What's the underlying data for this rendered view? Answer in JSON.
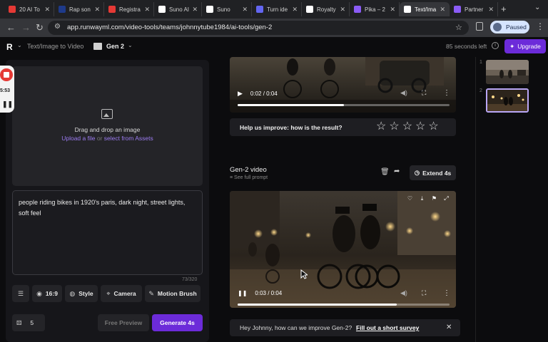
{
  "browser": {
    "tabs": [
      {
        "label": "20 AI To",
        "color": "#e53935"
      },
      {
        "label": "Rap son",
        "color": "#1e3a8a"
      },
      {
        "label": "Registra",
        "color": "#e53935"
      },
      {
        "label": "Suno AI",
        "color": "#ffffff"
      },
      {
        "label": "Suno",
        "color": "#ffffff"
      },
      {
        "label": "Turn ide",
        "color": "#6366f1"
      },
      {
        "label": "Royalty",
        "color": "#ffffff"
      },
      {
        "label": "Pika – 2",
        "color": "#8b5cf6"
      },
      {
        "label": "Text/Ima",
        "color": "#ffffff"
      },
      {
        "label": "Partner",
        "color": "#8b5cf6"
      }
    ],
    "url": "app.runwayml.com/video-tools/teams/johnnytube1984/ai-tools/gen-2",
    "profile_status": "Paused"
  },
  "header": {
    "breadcrumb": "Text/Image to Video",
    "project": "Gen 2",
    "seconds_left": "85 seconds left",
    "upgrade_label": "Upgrade"
  },
  "recorder": {
    "time": "5:53"
  },
  "left": {
    "drop_title": "Drag and drop an image",
    "upload_link": "Upload a file",
    "or_text": "or",
    "assets_link": "select from Assets",
    "prompt": "people riding bikes in 1920's paris, dark night, street lights, soft feel",
    "char_count": "73/320",
    "options": {
      "ratio": "16:9",
      "style": "Style",
      "camera": "Camera",
      "motion": "Motion Brush"
    },
    "seed_value": "5",
    "free_preview": "Free Preview",
    "generate": "Generate 4s"
  },
  "video1": {
    "time": "0:02 / 0:04",
    "progress": 0.5
  },
  "feedback": {
    "question": "Help us improve: how is the result?",
    "stars": 5
  },
  "video2": {
    "title": "Gen-2 video",
    "see_prompt": "See full prompt",
    "extend_label": "Extend 4s",
    "time": "0:03 / 0:04",
    "progress": 0.75
  },
  "survey": {
    "text": "Hey Johnny, how can we improve Gen-2?",
    "link": "Fill out a short survey"
  },
  "thumbnails": [
    {
      "index": "1",
      "selected": false
    },
    {
      "index": "2",
      "selected": true
    }
  ]
}
